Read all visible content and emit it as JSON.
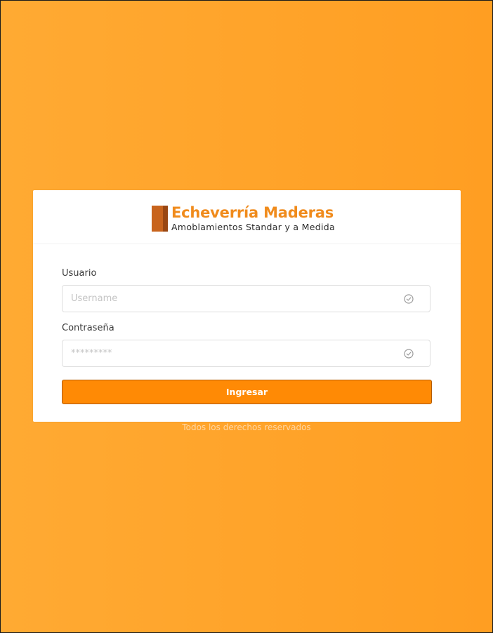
{
  "brand": {
    "title": "Echeverría Maderas",
    "subtitle": "Amoblamientos Standar y a Medida"
  },
  "form": {
    "username": {
      "label": "Usuario",
      "placeholder": "Username",
      "icon": "check-circle-icon"
    },
    "password": {
      "label": "Contraseña",
      "placeholder": "*********",
      "icon": "check-circle-icon"
    },
    "submit_label": "Ingresar"
  },
  "footer": {
    "text": "Todos los derechos reservados"
  },
  "colors": {
    "background": "#ffa42b",
    "accent": "#ff8a05",
    "brand": "#f08b1c",
    "card": "#ffffff"
  }
}
